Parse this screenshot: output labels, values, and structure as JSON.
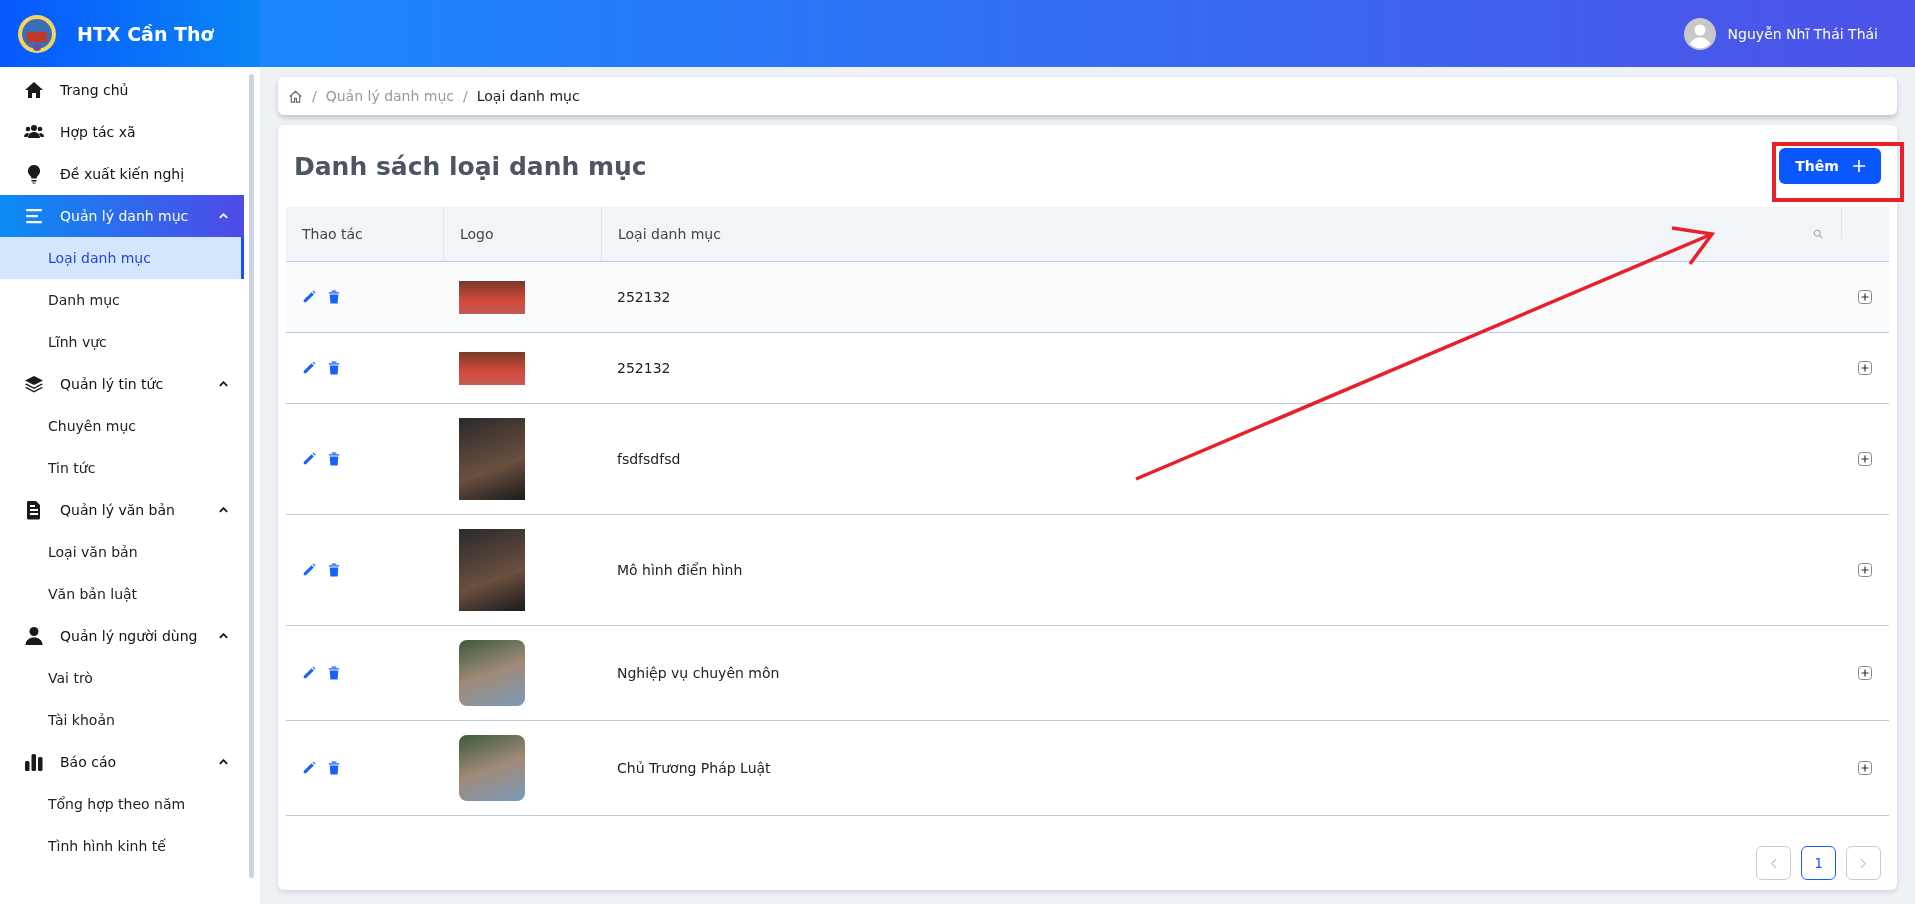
{
  "brand": {
    "name": "HTX Cần Thơ"
  },
  "user": {
    "name": "Nguyễn Nhĩ Thái Thái"
  },
  "sidebar": {
    "items": [
      {
        "label": "Trang chủ",
        "kind": "home",
        "selected": false
      },
      {
        "label": "Hợp tác xã",
        "kind": "users",
        "selected": false
      },
      {
        "label": "Đề xuất kiến nghị",
        "kind": "bulb",
        "selected": false
      },
      {
        "label": "Quản lý danh mục",
        "kind": "list",
        "selected": true,
        "expanded": true,
        "children": [
          {
            "label": "Loại danh mục",
            "selected": true
          },
          {
            "label": "Danh mục",
            "selected": false
          },
          {
            "label": "Lĩnh vực",
            "selected": false
          }
        ]
      },
      {
        "label": "Quản lý tin tức",
        "kind": "layers",
        "selected": false,
        "expanded": true,
        "children": [
          {
            "label": "Chuyên mục",
            "selected": false
          },
          {
            "label": "Tin tức",
            "selected": false
          }
        ]
      },
      {
        "label": "Quản lý văn bản",
        "kind": "file",
        "selected": false,
        "expanded": true,
        "children": [
          {
            "label": "Loại văn bản",
            "selected": false
          },
          {
            "label": "Văn bản luật",
            "selected": false
          }
        ]
      },
      {
        "label": "Quản lý người dùng",
        "kind": "user",
        "selected": false,
        "expanded": true,
        "children": [
          {
            "label": "Vai trò",
            "selected": false
          },
          {
            "label": "Tài khoản",
            "selected": false
          }
        ]
      },
      {
        "label": "Báo cáo",
        "kind": "chart",
        "selected": false,
        "expanded": true,
        "children": [
          {
            "label": "Tổng hợp theo năm",
            "selected": false
          },
          {
            "label": "Tình hình kinh tế",
            "selected": false
          }
        ]
      }
    ]
  },
  "breadcrumb": [
    {
      "separator": "/",
      "label": "Quản lý danh mục"
    },
    {
      "separator": "/",
      "label": "Loại danh mục"
    }
  ],
  "page": {
    "title": "Danh sách loại danh mục",
    "add_button": "Thêm"
  },
  "table": {
    "columns": [
      "Thao tác",
      "Logo",
      "Loại danh mục"
    ],
    "rows": [
      {
        "kind": "banner",
        "name": "252132"
      },
      {
        "kind": "banner",
        "name": "252132"
      },
      {
        "kind": "portrait",
        "name": "fsdfsdfsd"
      },
      {
        "kind": "portrait",
        "name": "Mô hình điển hình"
      },
      {
        "kind": "rounded",
        "name": "Nghiệp vụ chuyên môn"
      },
      {
        "kind": "rounded",
        "name": "Chủ Trương Pháp Luật"
      }
    ]
  },
  "pagination": {
    "prev_disabled": true,
    "next_disabled": true,
    "pages": [
      {
        "label": "1",
        "selected": true
      }
    ]
  }
}
